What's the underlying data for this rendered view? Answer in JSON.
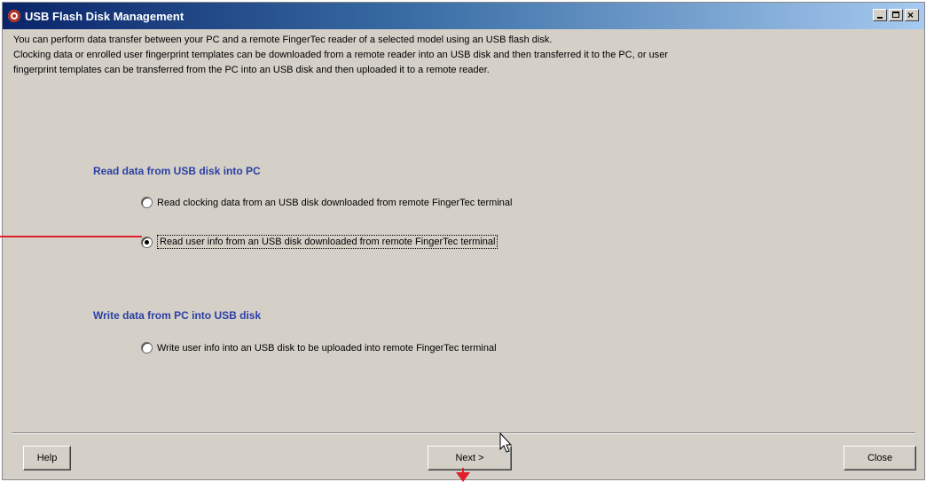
{
  "window": {
    "title": "USB Flash Disk Management",
    "icon": "app-clock-icon"
  },
  "description": {
    "line1": "You can perform data transfer between your PC and a remote FingerTec reader of a selected model using an USB flash disk.",
    "line2": "Clocking data or enrolled user fingerprint templates can be downloaded from a remote reader into an USB disk and then transferred it to the PC, or user",
    "line3": "fingerprint templates can be transferred from the PC into an USB disk and then uploaded it to a remote reader."
  },
  "read_section": {
    "title": "Read data from USB disk into PC",
    "options": [
      {
        "label": "Read clocking data from an USB disk downloaded from remote FingerTec terminal",
        "checked": false
      },
      {
        "label": "Read user info from an USB disk downloaded from remote FingerTec terminal",
        "checked": true
      }
    ]
  },
  "write_section": {
    "title": "Write data from PC into USB disk",
    "options": [
      {
        "label": "Write user info into an USB disk to be uploaded into remote FingerTec terminal",
        "checked": false
      }
    ]
  },
  "buttons": {
    "help": "Help",
    "next": "Next >",
    "close": "Close"
  },
  "colors": {
    "section_title": "#2b3fa4",
    "annotation": "#e0202a"
  }
}
